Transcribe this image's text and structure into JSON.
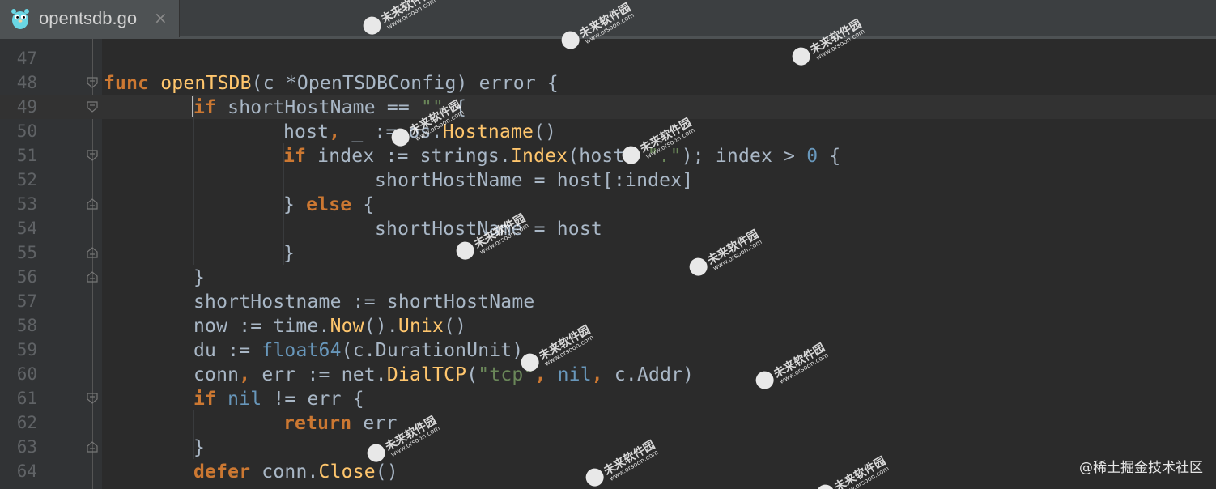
{
  "tab": {
    "title": "opentsdb.go",
    "close_glyph": "×",
    "icon": "gopher-icon"
  },
  "colors": {
    "editor_bg": "#2B2B2B",
    "gutter_bg": "#313335",
    "keyword": "#CC7832",
    "function": "#FFC66D",
    "number": "#6897BB",
    "string": "#6A8759",
    "text": "#A9B7C6",
    "line_number": "#606366"
  },
  "lines": [
    {
      "no": "47",
      "fold": "",
      "tokens": []
    },
    {
      "no": "48",
      "fold": "open",
      "tokens": [
        {
          "t": "func ",
          "c": "kw"
        },
        {
          "t": "openTSDB",
          "c": "fn"
        },
        {
          "t": "(c *OpenTSDBConfig) error {",
          "c": "plain"
        }
      ]
    },
    {
      "no": "49",
      "fold": "open",
      "tokens": [
        {
          "t": "if ",
          "c": "kw"
        },
        {
          "t": "shortHostName == ",
          "c": "plain"
        },
        {
          "t": "\"\"",
          "c": "str"
        },
        {
          "t": " {",
          "c": "plain"
        }
      ]
    },
    {
      "no": "50",
      "fold": "",
      "tokens": [
        {
          "t": "host",
          "c": "plain"
        },
        {
          "t": ",",
          "c": "kw"
        },
        {
          "t": " _ := os.",
          "c": "plain"
        },
        {
          "t": "Hostname",
          "c": "fn"
        },
        {
          "t": "()",
          "c": "plain"
        }
      ]
    },
    {
      "no": "51",
      "fold": "open",
      "tokens": [
        {
          "t": "if ",
          "c": "kw"
        },
        {
          "t": "index := strings.",
          "c": "plain"
        },
        {
          "t": "Index",
          "c": "fn"
        },
        {
          "t": "(host",
          "c": "plain"
        },
        {
          "t": ", ",
          "c": "kw"
        },
        {
          "t": "\".\"",
          "c": "str"
        },
        {
          "t": "); index > ",
          "c": "plain"
        },
        {
          "t": "0",
          "c": "num"
        },
        {
          "t": " {",
          "c": "plain"
        }
      ]
    },
    {
      "no": "52",
      "fold": "",
      "tokens": [
        {
          "t": "shortHostName = host[:index]",
          "c": "plain"
        }
      ]
    },
    {
      "no": "53",
      "fold": "close",
      "tokens": [
        {
          "t": "} ",
          "c": "plain"
        },
        {
          "t": "else",
          "c": "kw"
        },
        {
          "t": " {",
          "c": "plain"
        }
      ]
    },
    {
      "no": "54",
      "fold": "",
      "tokens": [
        {
          "t": "shortHostName = host",
          "c": "plain"
        }
      ]
    },
    {
      "no": "55",
      "fold": "close",
      "tokens": [
        {
          "t": "}",
          "c": "plain"
        }
      ]
    },
    {
      "no": "56",
      "fold": "close",
      "tokens": [
        {
          "t": "}",
          "c": "plain"
        }
      ]
    },
    {
      "no": "57",
      "fold": "",
      "tokens": [
        {
          "t": "shortHostname := shortHostName",
          "c": "plain"
        }
      ]
    },
    {
      "no": "58",
      "fold": "",
      "tokens": [
        {
          "t": "now := time.",
          "c": "plain"
        },
        {
          "t": "Now",
          "c": "fn"
        },
        {
          "t": "().",
          "c": "plain"
        },
        {
          "t": "Unix",
          "c": "fn"
        },
        {
          "t": "()",
          "c": "plain"
        }
      ]
    },
    {
      "no": "59",
      "fold": "",
      "tokens": [
        {
          "t": "du := ",
          "c": "plain"
        },
        {
          "t": "float64",
          "c": "num"
        },
        {
          "t": "(c.DurationUnit)",
          "c": "plain"
        }
      ]
    },
    {
      "no": "60",
      "fold": "",
      "tokens": [
        {
          "t": "conn",
          "c": "plain"
        },
        {
          "t": ",",
          "c": "kw"
        },
        {
          "t": " err := net.",
          "c": "plain"
        },
        {
          "t": "DialTCP",
          "c": "fn"
        },
        {
          "t": "(",
          "c": "plain"
        },
        {
          "t": "\"tcp\"",
          "c": "str"
        },
        {
          "t": ", ",
          "c": "kw"
        },
        {
          "t": "nil",
          "c": "num"
        },
        {
          "t": ", ",
          "c": "kw"
        },
        {
          "t": "c.Addr)",
          "c": "plain"
        }
      ]
    },
    {
      "no": "61",
      "fold": "open",
      "tokens": [
        {
          "t": "if ",
          "c": "kw"
        },
        {
          "t": "nil",
          "c": "num"
        },
        {
          "t": " != err {",
          "c": "plain"
        }
      ]
    },
    {
      "no": "62",
      "fold": "",
      "tokens": [
        {
          "t": "return ",
          "c": "kw"
        },
        {
          "t": "err",
          "c": "plain"
        }
      ]
    },
    {
      "no": "63",
      "fold": "close",
      "tokens": [
        {
          "t": "}",
          "c": "plain"
        }
      ]
    },
    {
      "no": "64",
      "fold": "",
      "tokens": [
        {
          "t": "defer ",
          "c": "kw"
        },
        {
          "t": "conn.",
          "c": "plain"
        },
        {
          "t": "Close",
          "c": "fn"
        },
        {
          "t": "()",
          "c": "plain"
        }
      ]
    }
  ],
  "watermarks": {
    "brand": "未来软件园",
    "site": "www.orsoon.com"
  },
  "footer": {
    "credit": "@稀土掘金技术社区"
  }
}
